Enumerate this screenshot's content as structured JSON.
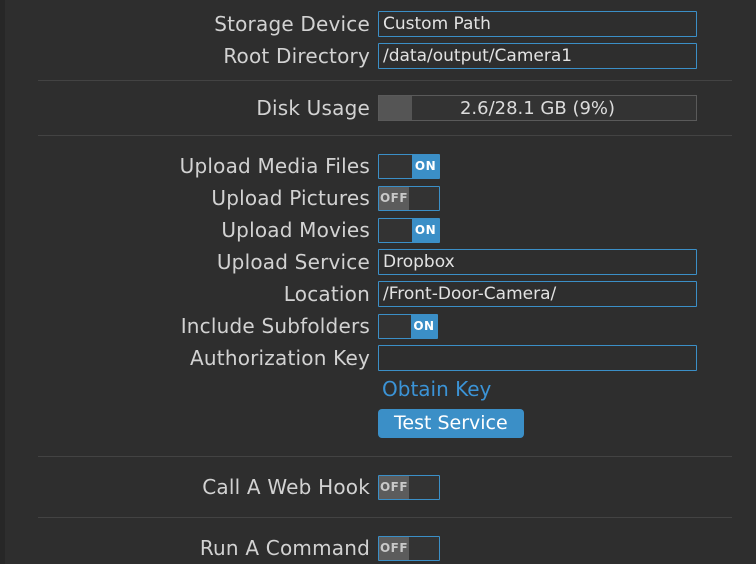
{
  "theme": {
    "background": "#2e2e2e",
    "accent": "#3b8fc7",
    "link_color": "#3b93d6",
    "label_color": "#d2d2d2",
    "divider_color": "#434343"
  },
  "sections": {
    "storage": {
      "storage_device": {
        "label": "Storage Device",
        "value": "Custom Path",
        "placeholder": ""
      },
      "root_directory": {
        "label": "Root Directory",
        "value": "/data/output/Camera1",
        "placeholder": ""
      }
    },
    "disk": {
      "disk_usage": {
        "label": "Disk Usage",
        "text": "2.6/28.1 GB (9%)",
        "used_gb": 2.6,
        "total_gb": 28.1,
        "percent": 9
      }
    },
    "upload": {
      "upload_media_files": {
        "label": "Upload Media Files",
        "state": "ON"
      },
      "upload_pictures": {
        "label": "Upload Pictures",
        "state": "OFF"
      },
      "upload_movies": {
        "label": "Upload Movies",
        "state": "ON"
      },
      "upload_service": {
        "label": "Upload Service",
        "value": "Dropbox",
        "placeholder": ""
      },
      "location": {
        "label": "Location",
        "value": "/Front-Door-Camera/",
        "placeholder": ""
      },
      "include_subfolders": {
        "label": "Include Subfolders",
        "state": "ON"
      },
      "authorization_key": {
        "label": "Authorization Key",
        "value": "",
        "placeholder": ""
      },
      "obtain_key_link": "Obtain Key",
      "test_service_button": "Test Service"
    },
    "webhook": {
      "call_a_web_hook": {
        "label": "Call A Web Hook",
        "state": "OFF"
      }
    },
    "command": {
      "run_a_command": {
        "label": "Run A Command",
        "state": "OFF"
      }
    }
  }
}
